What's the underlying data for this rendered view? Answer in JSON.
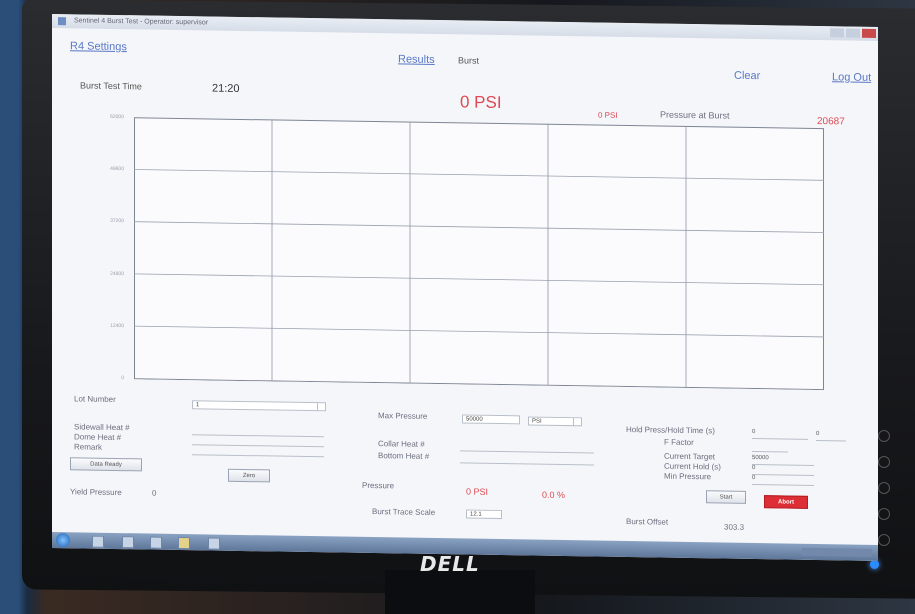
{
  "window": {
    "title": "Sentinel 4 Burst Test - Operator: supervisor"
  },
  "nav": {
    "settings": "R4 Settings",
    "results": "Results",
    "burst": "Burst",
    "clear": "Clear",
    "logout": "Log Out"
  },
  "header": {
    "burst_time_label": "Burst Test Time",
    "burst_time_value": "21:20",
    "pressure_big": "0 PSI",
    "pressure_small": "0 PSI",
    "pressure_at_burst_label": "Pressure at Burst",
    "pressure_at_burst_value": "20687"
  },
  "chart_data": {
    "type": "line",
    "series": [],
    "ylim": [
      0,
      62000
    ],
    "yticks": [
      "62000",
      "49600",
      "37200",
      "24800",
      "12400",
      "0"
    ],
    "grid": true,
    "x_divisions": 5
  },
  "form": {
    "lot_number_label": "Lot Number",
    "lot_number_value": "1",
    "sidewall_heat_label": "Sidewall Heat #",
    "dome_heat_label": "Dome Heat #",
    "remark_label": "Remark",
    "zero_label": "Zero",
    "data_ready_label": "Data Ready",
    "yield_pressure_label": "Yield Pressure",
    "yield_pressure_value": "0",
    "max_pressure_label": "Max Pressure",
    "max_pressure_value": "50000",
    "max_pressure_unit": "PSI",
    "collar_heat_label": "Collar Heat #",
    "bottom_heat_label": "Bottom Heat #",
    "pressure_label": "Pressure",
    "pressure_value": "0 PSI",
    "pressure_percent": "0.0 %",
    "burst_trace_scale_label": "Burst Trace Scale",
    "burst_trace_scale_value": "12.1",
    "hold_press_label": "Hold Press/Hold Time (s)",
    "hold_press_value": "0",
    "hold_time_value": "0",
    "f_factor_label": "F Factor",
    "current_target_label": "Current Target",
    "current_target_value": "50000",
    "current_hold_label": "Current Hold (s)",
    "current_hold_value": "0",
    "min_pressure_label": "Min Pressure",
    "min_pressure_value": "0",
    "start_label": "Start",
    "abort_label": "Abort",
    "burst_offset_label": "Burst Offset",
    "burst_offset_value": "303.3"
  },
  "monitor": {
    "brand": "DELL"
  }
}
